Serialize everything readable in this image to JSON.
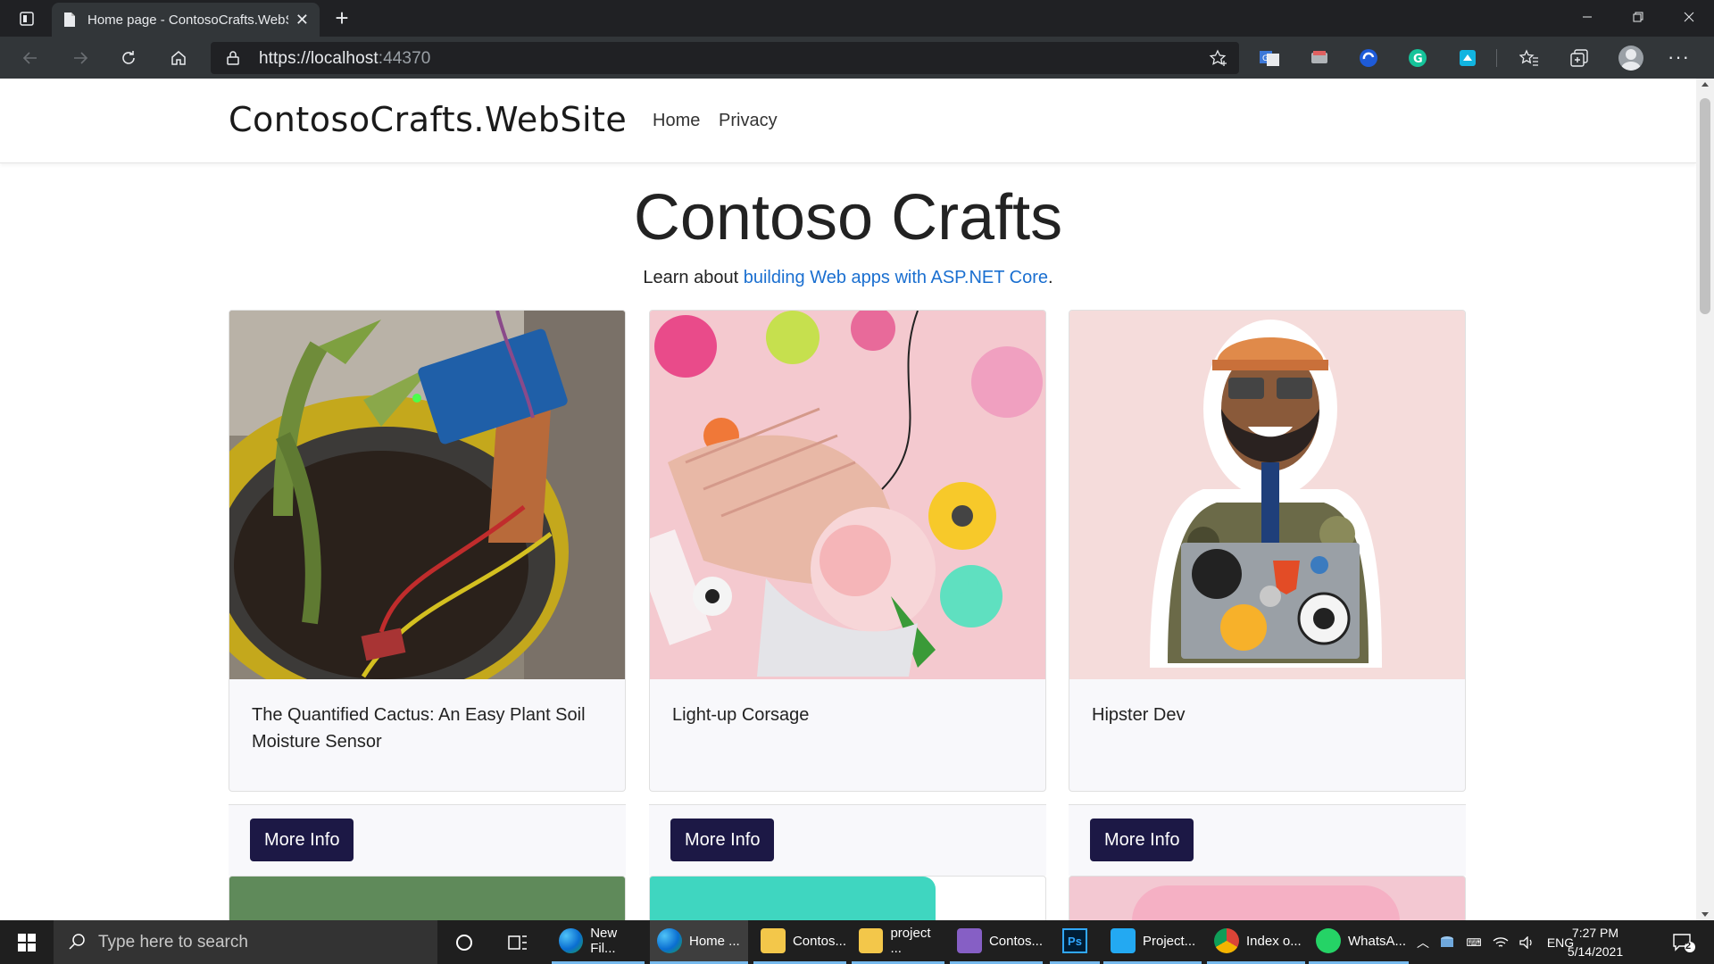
{
  "browser": {
    "tab_title": "Home page - ContosoCrafts.WebSite",
    "url_host": "https://localhost",
    "url_port": ":44370"
  },
  "site": {
    "brand": "ContosoCrafts.WebSite",
    "nav": [
      {
        "label": "Home"
      },
      {
        "label": "Privacy"
      }
    ],
    "hero_title": "Contoso Crafts",
    "hero_sub_before": "Learn about ",
    "hero_sub_link": "building Web apps with ASP.NET Core",
    "hero_sub_after": "."
  },
  "products": [
    {
      "title": "The Quantified Cactus: An Easy Plant Soil Moisture Sensor",
      "button": "More Info"
    },
    {
      "title": "Light-up Corsage",
      "button": "More Info"
    },
    {
      "title": "Hipster Dev",
      "button": "More Info"
    }
  ],
  "taskbar": {
    "search_placeholder": "Type here to search",
    "apps": [
      {
        "label": "New Fil...",
        "icon": "edge-icon"
      },
      {
        "label": "Home ...",
        "icon": "edge-icon"
      },
      {
        "label": "Contos...",
        "icon": "folder-icon"
      },
      {
        "label": "project ...",
        "icon": "folder-icon"
      },
      {
        "label": "Contos...",
        "icon": "visual-studio-icon"
      },
      {
        "label": "Ps",
        "icon": "photoshop-icon"
      },
      {
        "label": "Project...",
        "icon": "vscode-icon"
      },
      {
        "label": "Index o...",
        "icon": "chrome-icon"
      },
      {
        "label": "WhatsA...",
        "icon": "whatsapp-icon"
      }
    ],
    "language": "ENG",
    "time": "7:27 PM",
    "date": "5/14/2021",
    "notification_count": "2"
  }
}
